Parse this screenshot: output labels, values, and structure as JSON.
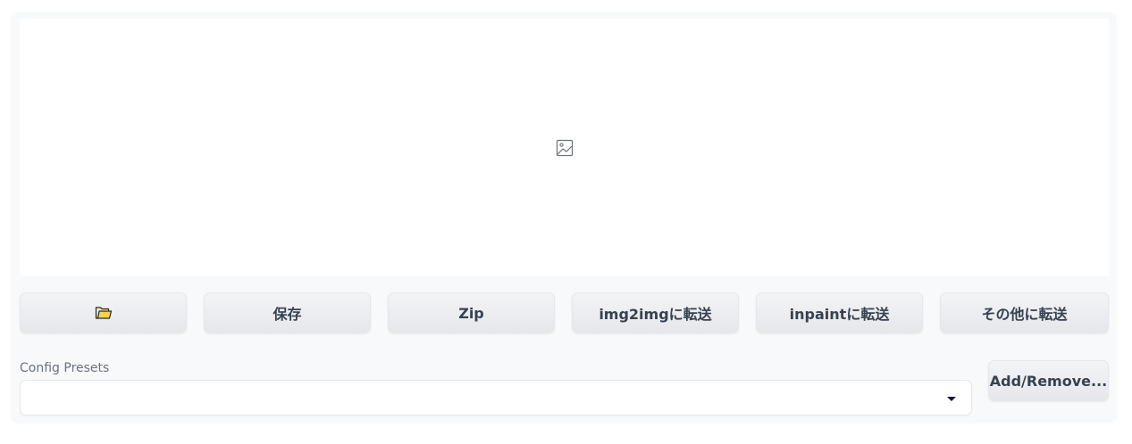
{
  "gallery": {
    "icon": "image-placeholder-icon"
  },
  "buttons": {
    "open_folder_icon": "folder-icon",
    "save_label": "保存",
    "zip_label": "Zip",
    "send_img2img_label": "img2imgに転送",
    "send_inpaint_label": "inpaintに転送",
    "send_other_label": "その他に転送"
  },
  "config_presets": {
    "label": "Config Presets",
    "selected_value": "",
    "add_remove_label": "Add/Remove..."
  },
  "colors": {
    "panel_bg": "#f8f9fa",
    "button_text": "#374151",
    "label_text": "#6b7280",
    "folder_fill": "#fcd34d"
  }
}
